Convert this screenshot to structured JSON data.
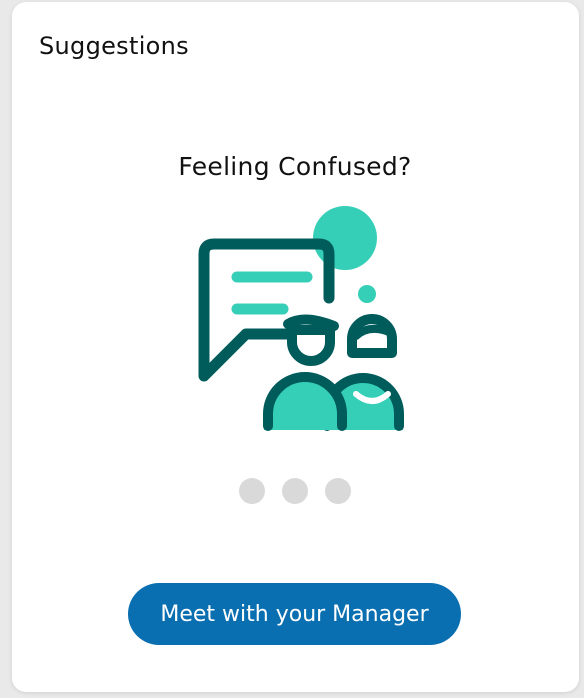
{
  "card": {
    "title": "Suggestions"
  },
  "suggestion": {
    "headline": "Feeling Confused?",
    "illustration_icon": "chat-people-icon",
    "cta_label": "Meet with your Manager"
  },
  "pagination": {
    "count": 3
  },
  "colors": {
    "accent_teal": "#35cfb8",
    "dark_teal": "#005b5b",
    "button_blue": "#0a6fb0",
    "dot_gray": "#d9d9d9"
  }
}
